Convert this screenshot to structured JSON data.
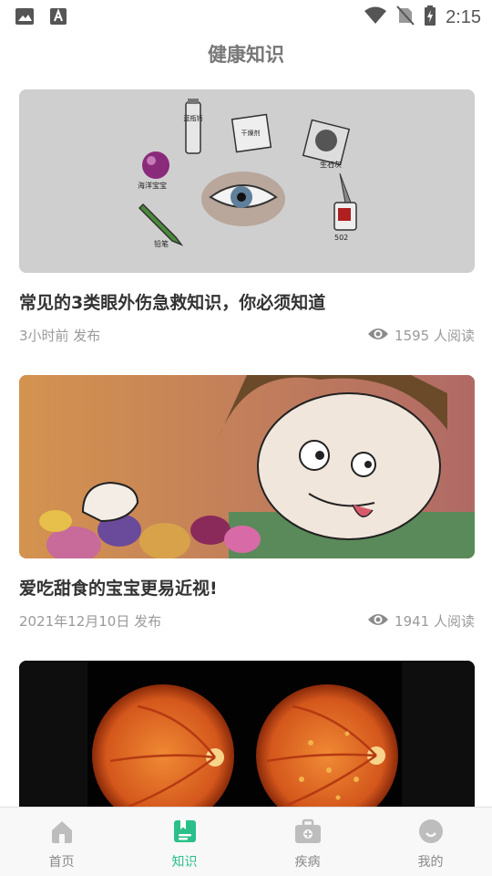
{
  "status_bar": {
    "time": "2:15"
  },
  "header": {
    "title": "健康知识"
  },
  "articles": [
    {
      "title": "常见的3类眼外伤急救知识，你必须知道",
      "published": "3小时前 发布",
      "views": "1595 人阅读",
      "image_labels": {
        "bottle": "蓝瓶钙",
        "packet": "干燥剂",
        "lime": "生石灰",
        "ball": "海洋宝宝",
        "pencil": "铅笔",
        "glue": "502"
      }
    },
    {
      "title": "爱吃甜食的宝宝更易近视!",
      "published": "2021年12月10日 发布",
      "views": "1941 人阅读"
    },
    {
      "title": "",
      "published": "",
      "views": ""
    }
  ],
  "tabbar": {
    "items": [
      {
        "label": "首页",
        "icon": "home-icon",
        "active": false
      },
      {
        "label": "知识",
        "icon": "knowledge-icon",
        "active": true
      },
      {
        "label": "疾病",
        "icon": "disease-icon",
        "active": false
      },
      {
        "label": "我的",
        "icon": "profile-icon",
        "active": false
      }
    ],
    "active_color": "#2bbf8a",
    "inactive_color": "#bdbdbd"
  }
}
